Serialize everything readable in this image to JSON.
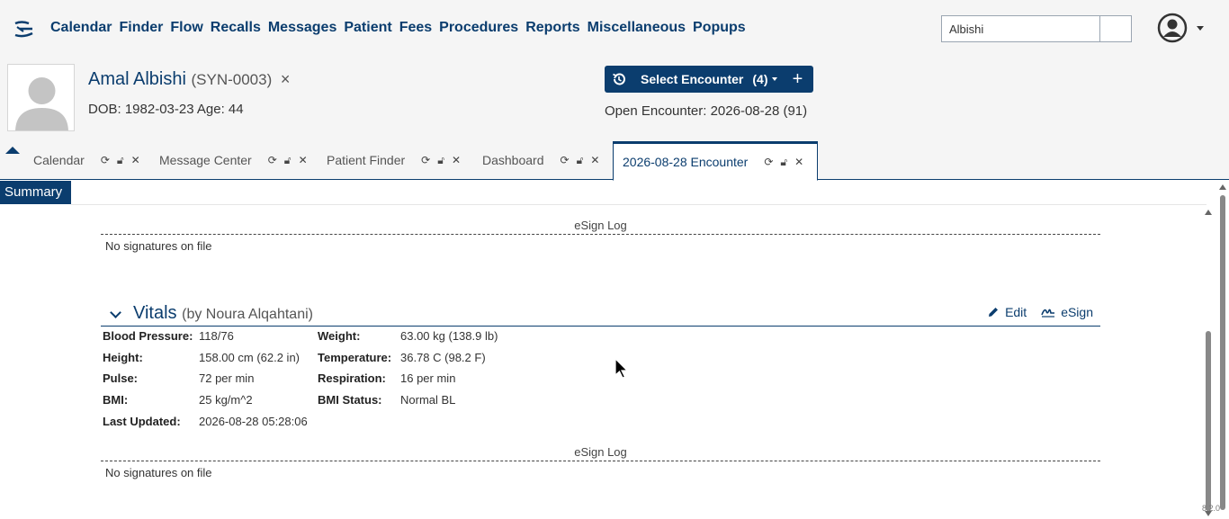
{
  "nav": {
    "menu": [
      "Calendar",
      "Finder",
      "Flow",
      "Recalls",
      "Messages",
      "Patient",
      "Fees",
      "Procedures",
      "Reports",
      "Miscellaneous",
      "Popups"
    ],
    "search_value": "Albishi",
    "user_icon": "user-circle-icon"
  },
  "patient": {
    "name": "Amal Albishi",
    "id": "(SYN-0003)",
    "close": "×",
    "dob_line": "DOB: 1982-03-23 Age: 44",
    "select_encounter": "Select Encounter",
    "encounter_count": "(4)",
    "add": "+",
    "open_encounter": "Open Encounter: 2026-08-28 (91)"
  },
  "tabs": [
    {
      "label": "Calendar"
    },
    {
      "label": "Message Center"
    },
    {
      "label": "Patient Finder"
    },
    {
      "label": "Dashboard"
    },
    {
      "label": "2026-08-28 Encounter",
      "active": true
    }
  ],
  "summary_label": "Summary",
  "esign_log": "eSign Log",
  "no_signatures": "No signatures on file",
  "vitals": {
    "title": "Vitals",
    "by": "(by Noura Alqahtani)",
    "edit": "Edit",
    "esign": "eSign",
    "rows": [
      {
        "l1": "Blood Pressure:",
        "v1": "118/76",
        "l2": "Weight:",
        "v2": "63.00 kg (138.9 lb)"
      },
      {
        "l1": "Height:",
        "v1": "158.00 cm (62.2 in)",
        "l2": "Temperature:",
        "v2": "36.78 C (98.2 F)"
      },
      {
        "l1": "Pulse:",
        "v1": "72 per min",
        "l2": "Respiration:",
        "v2": "16 per min"
      },
      {
        "l1": "BMI:",
        "v1": "25 kg/m^2",
        "l2": "BMI Status:",
        "v2": "Normal BL"
      },
      {
        "l1": "Last Updated:",
        "v1": "2026-08-28 05:28:06",
        "l2": "",
        "v2": ""
      }
    ]
  },
  "version": "8.2.0",
  "colors": {
    "brand": "#0b3d6e",
    "header_bg": "#f5f5f5"
  }
}
